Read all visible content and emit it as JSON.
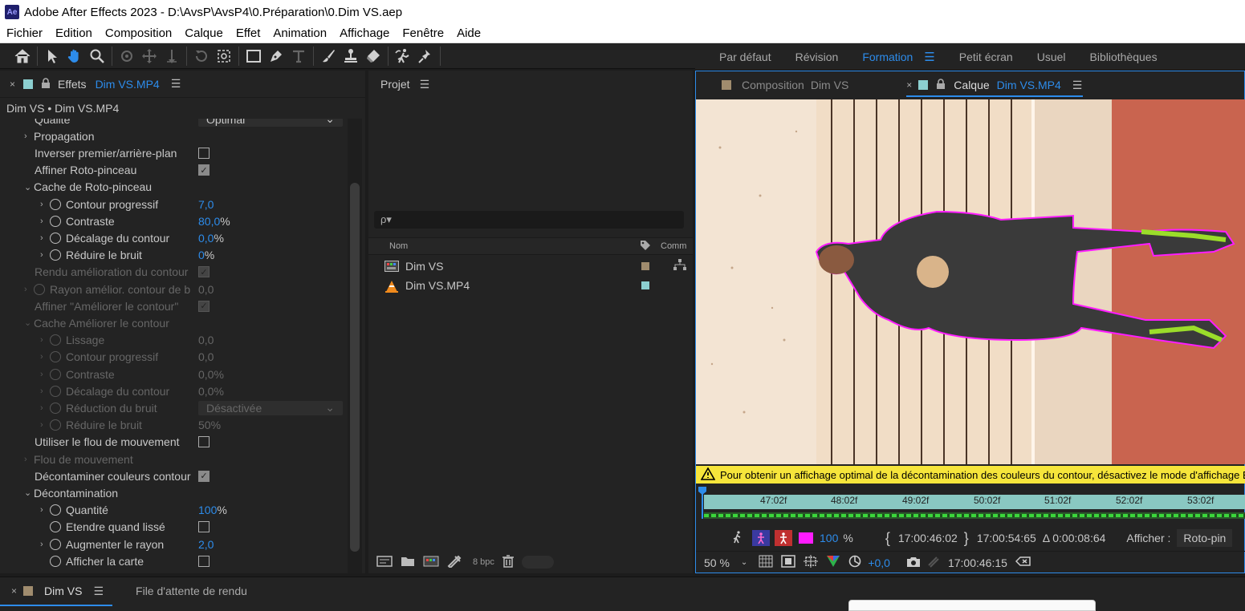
{
  "app": {
    "title": "Adobe After Effects 2023 - D:\\AvsP\\AvsP4\\0.Préparation\\0.Dim VS.aep",
    "logo": "Ae"
  },
  "menu": [
    "Fichier",
    "Edition",
    "Composition",
    "Calque",
    "Effet",
    "Animation",
    "Affichage",
    "Fenêtre",
    "Aide"
  ],
  "toolbar": {
    "icons": [
      "home-icon",
      "selection-arrow-icon",
      "hand-icon",
      "zoom-icon",
      "orbit-icon",
      "pan-behind-icon",
      "dolly-icon",
      "rotate-icon",
      "pan-under-icon",
      "rectangle-icon",
      "pen-icon",
      "type-icon",
      "brush-icon",
      "clone-stamp-icon",
      "eraser-icon",
      "roto-brush-icon",
      "puppet-pin-icon"
    ]
  },
  "workspaces": {
    "items": [
      "Par défaut",
      "Révision",
      "Formation",
      "Petit écran",
      "Usuel",
      "Bibliothèques"
    ],
    "active": "Formation"
  },
  "effects_panel": {
    "close": "×",
    "tab_label": "Effets",
    "tab_layer": "Dim VS.MP4",
    "subtitle": "Dim VS • Dim VS.MP4",
    "rows": [
      {
        "label": "Qualité",
        "value": "Optimal",
        "kind": "dropdown",
        "indent": 1,
        "dim": false,
        "partial": true
      },
      {
        "label": "Propagation",
        "kind": "group",
        "indent": 1,
        "dim": false,
        "chev": "›"
      },
      {
        "label": "Inverser premier/arrière-plan",
        "kind": "checkbox",
        "checked": false,
        "indent": 1,
        "dim": false
      },
      {
        "label": "Affiner Roto-pinceau",
        "kind": "checkbox",
        "checked": true,
        "indent": 1,
        "dim": false
      },
      {
        "label": "Cache de Roto-pinceau",
        "kind": "group",
        "indent": 1,
        "dim": false,
        "chev": "⌄"
      },
      {
        "label": "Contour progressif",
        "num": "7,0",
        "unit": "",
        "kind": "num",
        "indent": 2,
        "dim": false
      },
      {
        "label": "Contraste",
        "num": "80,0",
        "unit": "%",
        "kind": "num",
        "indent": 2,
        "dim": false
      },
      {
        "label": "Décalage du contour",
        "num": "0,0",
        "unit": "%",
        "kind": "num",
        "indent": 2,
        "dim": false
      },
      {
        "label": "Réduire le bruit",
        "num": "0",
        "unit": " %",
        "kind": "num",
        "indent": 2,
        "dim": false
      },
      {
        "label": "Rendu amélioration du contour",
        "kind": "checkbox",
        "checked": true,
        "indent": 1,
        "dim": true
      },
      {
        "label": "Rayon amélior. contour de b",
        "num": "0,0",
        "unit": "",
        "kind": "num",
        "indent": 1,
        "dim": true,
        "stopwatch": true
      },
      {
        "label": "Affiner \"Améliorer le contour\"",
        "kind": "checkbox",
        "checked": true,
        "indent": 1,
        "dim": true
      },
      {
        "label": "Cache Améliorer le contour",
        "kind": "group",
        "indent": 1,
        "dim": true,
        "chev": "⌄"
      },
      {
        "label": "Lissage",
        "num": "0,0",
        "unit": "",
        "kind": "num",
        "indent": 2,
        "dim": true
      },
      {
        "label": "Contour progressif",
        "num": "0,0",
        "unit": "",
        "kind": "num",
        "indent": 2,
        "dim": true
      },
      {
        "label": "Contraste",
        "num": "0,0",
        "unit": "%",
        "kind": "num",
        "indent": 2,
        "dim": true
      },
      {
        "label": "Décalage du contour",
        "num": "0,0",
        "unit": "%",
        "kind": "num",
        "indent": 2,
        "dim": true
      },
      {
        "label": "Réduction du bruit",
        "value": "Désactivée",
        "kind": "dropdown",
        "indent": 2,
        "dim": true
      },
      {
        "label": "Réduire le bruit",
        "num": "50",
        "unit": "%",
        "kind": "num",
        "indent": 2,
        "dim": true
      },
      {
        "label": "Utiliser le flou de mouvement",
        "kind": "checkbox",
        "checked": false,
        "indent": 1,
        "dim": false
      },
      {
        "label": "Flou de mouvement",
        "kind": "group",
        "indent": 1,
        "dim": true,
        "chev": "›"
      },
      {
        "label": "Décontaminer couleurs contour",
        "kind": "checkbox",
        "checked": true,
        "indent": 1,
        "dim": false
      },
      {
        "label": "Décontamination",
        "kind": "group",
        "indent": 1,
        "dim": false,
        "chev": "⌄"
      },
      {
        "label": "Quantité",
        "num": "100",
        "unit": "%",
        "kind": "num",
        "indent": 2,
        "dim": false
      },
      {
        "label": "Etendre quand lissé",
        "kind": "checkbox",
        "checked": false,
        "indent": 2,
        "dim": false,
        "stopwatch": true,
        "nochev": true
      },
      {
        "label": "Augmenter le rayon",
        "num": "2,0",
        "unit": "",
        "kind": "num",
        "indent": 2,
        "dim": false
      },
      {
        "label": "Afficher la carte",
        "kind": "checkbox",
        "checked": false,
        "indent": 2,
        "dim": false,
        "stopwatch": true,
        "nochev": true
      }
    ]
  },
  "project_panel": {
    "title": "Projet",
    "search_placeholder": "ρ▾",
    "col_name": "Nom",
    "col_comment": "Comm",
    "items": [
      {
        "name": "Dim VS",
        "icon": "composition-icon",
        "tag": "#a08c6e"
      },
      {
        "name": "Dim VS.MP4",
        "icon": "vlc-cone-icon",
        "tag": "#8ccfd0"
      }
    ],
    "bpc": "8 bpc"
  },
  "viewer": {
    "comp_tab_label": "Composition",
    "comp_tab_name": "Dim VS",
    "layer_tab_label": "Calque",
    "layer_tab_name": "Dim VS.MP4",
    "warning": "Pour obtenir un affichage optimal de la décontamination des couleurs du contour, désactivez le mode d'affichage Bordu",
    "ticks": [
      "47:02f",
      "48:02f",
      "49:02f",
      "50:02f",
      "51:02f",
      "52:02f",
      "53:02f"
    ],
    "zoom_pct": "100",
    "pct_sign": "%",
    "in_time": "17:00:46:02",
    "out_time": "17:00:54:65",
    "duration": "Δ 0:00:08:64",
    "afficher_label": "Afficher :",
    "afficher_value": "Roto-pin",
    "magnification": "50 %",
    "exposure": "+0,0",
    "current_time": "17:00:46:15"
  },
  "bottom": {
    "close": "×",
    "comp_tab": "Dim VS",
    "render_queue": "File d'attente de rendu"
  },
  "colors": {
    "accent": "#2d8ceb",
    "warning_bg": "#f6e53b",
    "roto_outline": "#ff1cff",
    "timeline_ruler": "#89c8c2"
  }
}
